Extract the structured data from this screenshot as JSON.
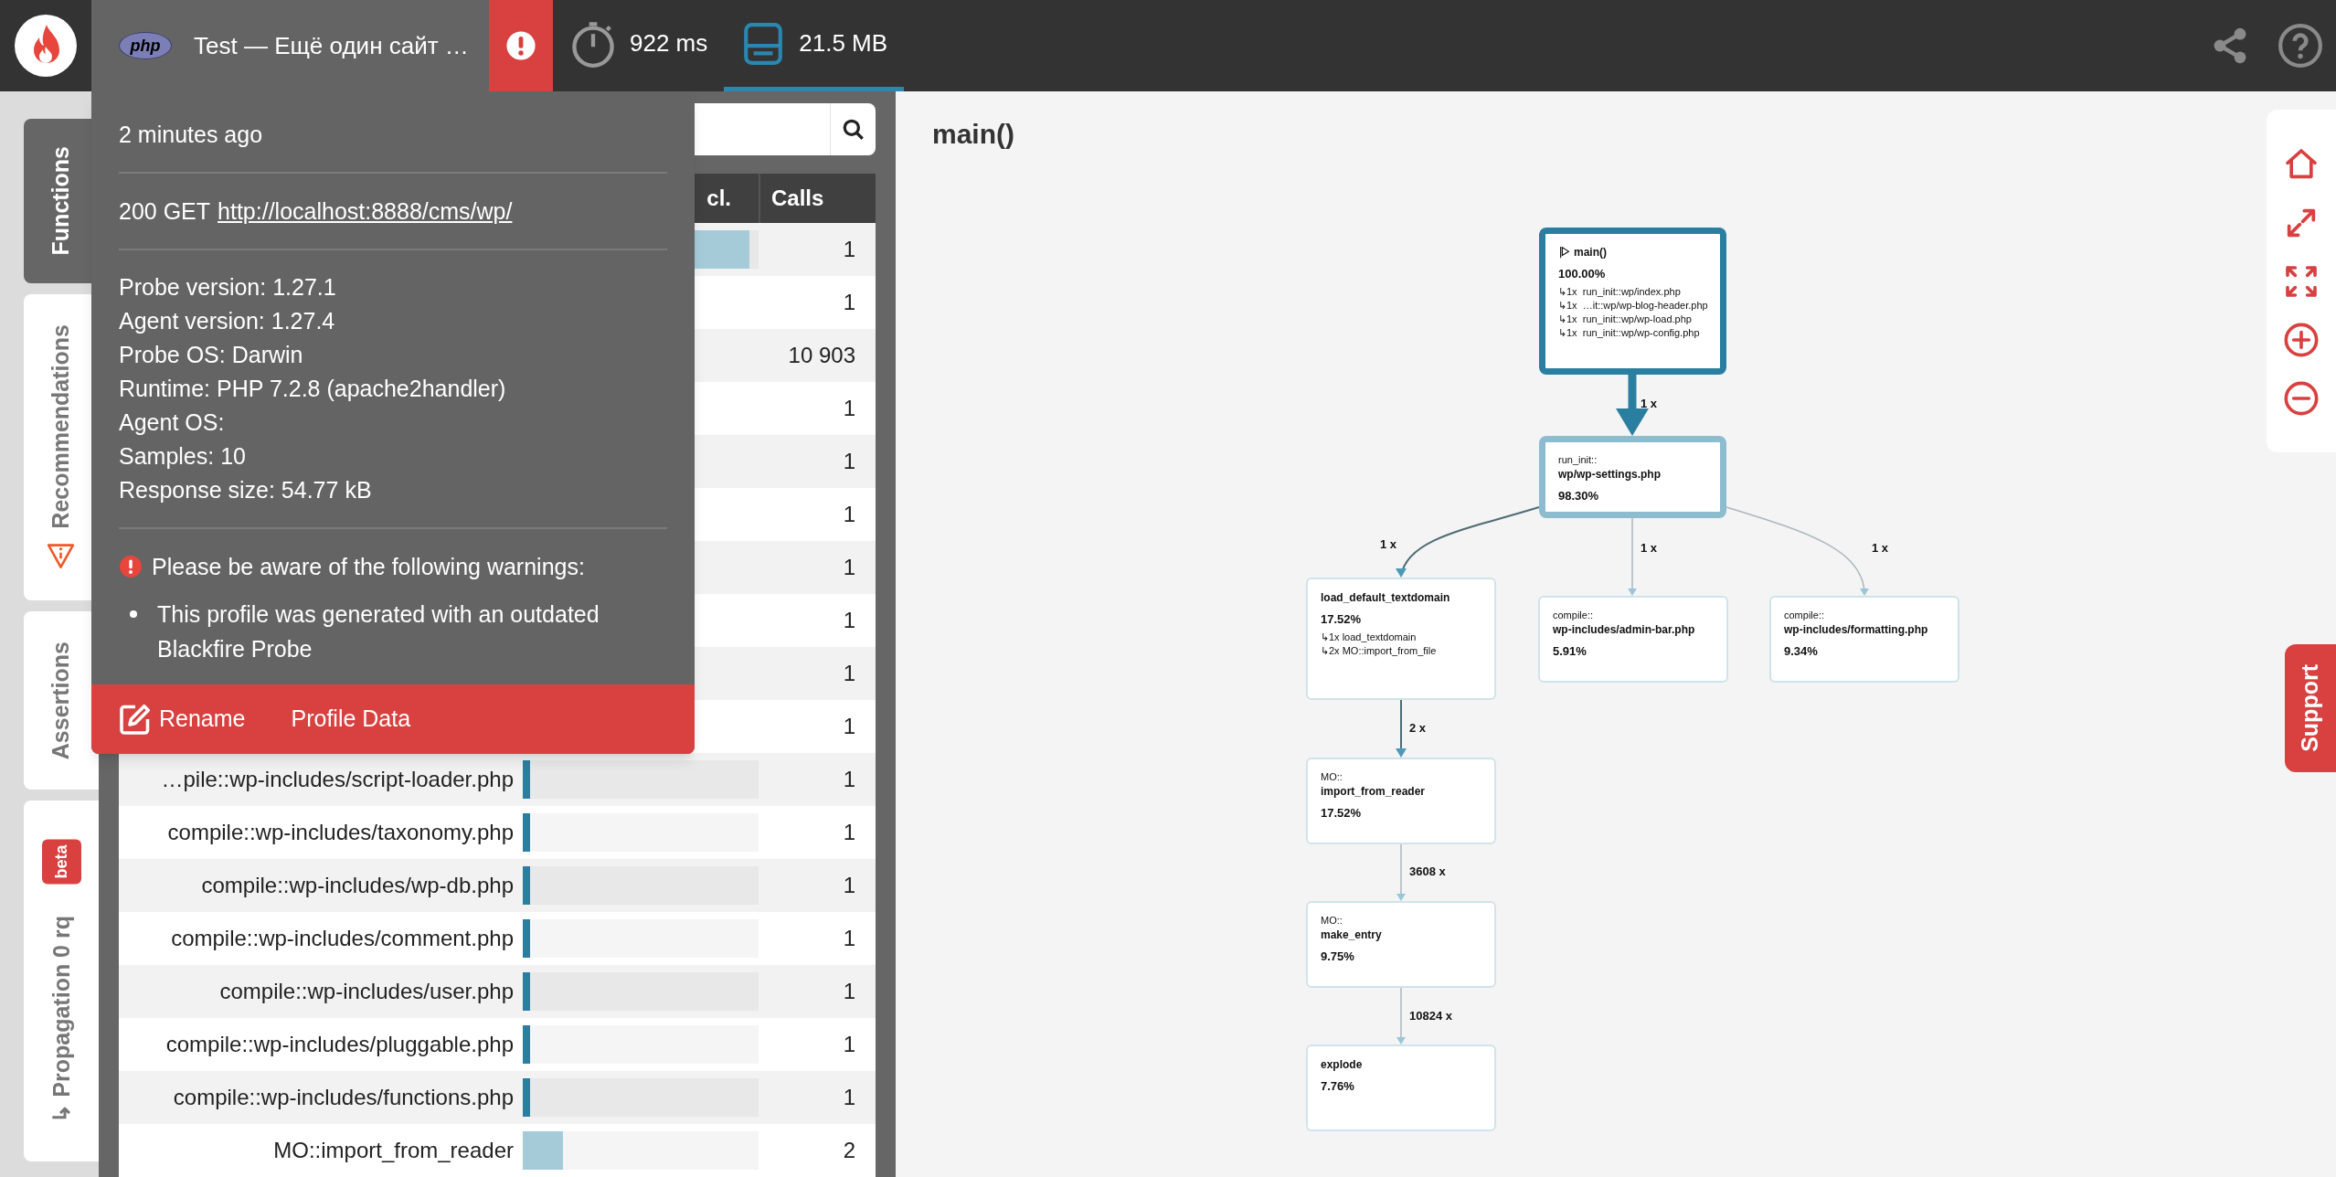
{
  "header": {
    "runtime_badge": "php",
    "title": "Test — Ещё один сайт …",
    "has_warnings": true,
    "metrics": [
      {
        "kind": "time",
        "label": "922 ms",
        "selected": false
      },
      {
        "kind": "memory",
        "label": "21.5 MB",
        "selected": true
      }
    ]
  },
  "side_tabs": [
    {
      "kind": "plain",
      "label": "Functions",
      "selected": true
    },
    {
      "kind": "warning",
      "label": "Recommendations",
      "selected": false
    },
    {
      "kind": "plain",
      "label": "Assertions",
      "selected": false
    },
    {
      "kind": "propagation",
      "label": "↳ Propagation 0 rq",
      "badge": "beta",
      "selected": false
    }
  ],
  "table": {
    "columns": [
      {
        "label": "cl."
      },
      {
        "label": "Calls"
      }
    ],
    "rows": [
      {
        "level": 0.96,
        "color": "#a5cbd8",
        "calls": "1"
      },
      {
        "calls": "1"
      },
      {
        "calls": "10 903"
      },
      {
        "calls": "1"
      },
      {
        "calls": "1"
      },
      {
        "calls": "1"
      },
      {
        "calls": "1"
      },
      {
        "calls": "1"
      },
      {
        "calls": "1"
      },
      {
        "calls": "1"
      },
      {
        "function": "…pile::wp-includes/script-loader.php",
        "level": 0.03,
        "color": "#2a7fa0",
        "calls": "1"
      },
      {
        "function": "compile::wp-includes/taxonomy.php",
        "level": 0.03,
        "color": "#2a7fa0",
        "calls": "1"
      },
      {
        "function": "compile::wp-includes/wp-db.php",
        "level": 0.03,
        "color": "#2a7fa0",
        "calls": "1"
      },
      {
        "function": "compile::wp-includes/comment.php",
        "level": 0.03,
        "color": "#2a7fa0",
        "calls": "1"
      },
      {
        "function": "compile::wp-includes/user.php",
        "level": 0.03,
        "color": "#2a7fa0",
        "calls": "1"
      },
      {
        "function": "compile::wp-includes/pluggable.php",
        "level": 0.03,
        "color": "#2a7fa0",
        "calls": "1"
      },
      {
        "function": "compile::wp-includes/functions.php",
        "level": 0.03,
        "color": "#2a7fa0",
        "calls": "1"
      },
      {
        "function": "MO::import_from_reader",
        "level": 0.17,
        "color": "#a5cbd8",
        "calls": "2"
      }
    ]
  },
  "profile_popup": {
    "time": "2 minutes ago",
    "request": {
      "status": "200 GET",
      "url": "http://localhost:8888/cms/wp/"
    },
    "details": [
      "Probe version: 1.27.1",
      "Agent version: 1.27.4",
      "Probe OS: Darwin",
      "Runtime: PHP 7.2.8 (apache2handler)",
      "Agent OS:",
      "Samples: 10",
      "Response size: 54.77 kB"
    ],
    "warnings_title": "Please be aware of the following warnings:",
    "warnings": [
      "This profile was generated with an outdated Blackfire Probe"
    ],
    "actions": [
      {
        "kind": "rename",
        "label": "Rename"
      },
      {
        "kind": "plain",
        "label": "Profile Data"
      }
    ]
  },
  "graph": {
    "title": "main()",
    "nodes": [
      {
        "kind": "root",
        "name": "main()",
        "percent": "100.00%",
        "calls": [
          "↳1x  run_init::wp/index.php",
          "↳1x  …it::wp/wp-blog-header.php",
          "↳1x  run_init::wp/wp-load.php",
          "↳1x  run_init::wp/wp-config.php"
        ]
      },
      {
        "kind": "hot",
        "prefix": "run_init::",
        "name": "wp/wp-settings.php",
        "percent": "98.30%"
      },
      {
        "kind": "normal",
        "name": "load_default_textdomain",
        "percent": "17.52%",
        "calls": [
          "↳1x load_textdomain",
          "↳2x MO::import_from_file"
        ]
      },
      {
        "kind": "normal",
        "prefix": "compile::",
        "name": "wp-includes/admin-bar.php",
        "percent": "5.91%"
      },
      {
        "kind": "normal",
        "prefix": "compile::",
        "name": "wp-includes/formatting.php",
        "percent": "9.34%"
      },
      {
        "kind": "normal",
        "prefix": "MO::",
        "name": "import_from_reader",
        "percent": "17.52%"
      },
      {
        "kind": "normal",
        "prefix": "MO::",
        "name": "make_entry",
        "percent": "9.75%"
      },
      {
        "kind": "normal",
        "name": "explode",
        "percent": "7.76%"
      }
    ],
    "edges": [
      {
        "kind": "heavy",
        "label": "1 x"
      },
      {
        "kind": "medium",
        "label": "1 x"
      },
      {
        "kind": "light",
        "label": "1 x"
      },
      {
        "kind": "light",
        "label": "1 x"
      },
      {
        "kind": "medium",
        "label": "2 x"
      },
      {
        "kind": "light",
        "label": "3608 x"
      },
      {
        "kind": "light",
        "label": "10824 x"
      }
    ]
  },
  "support_tab": "Support"
}
